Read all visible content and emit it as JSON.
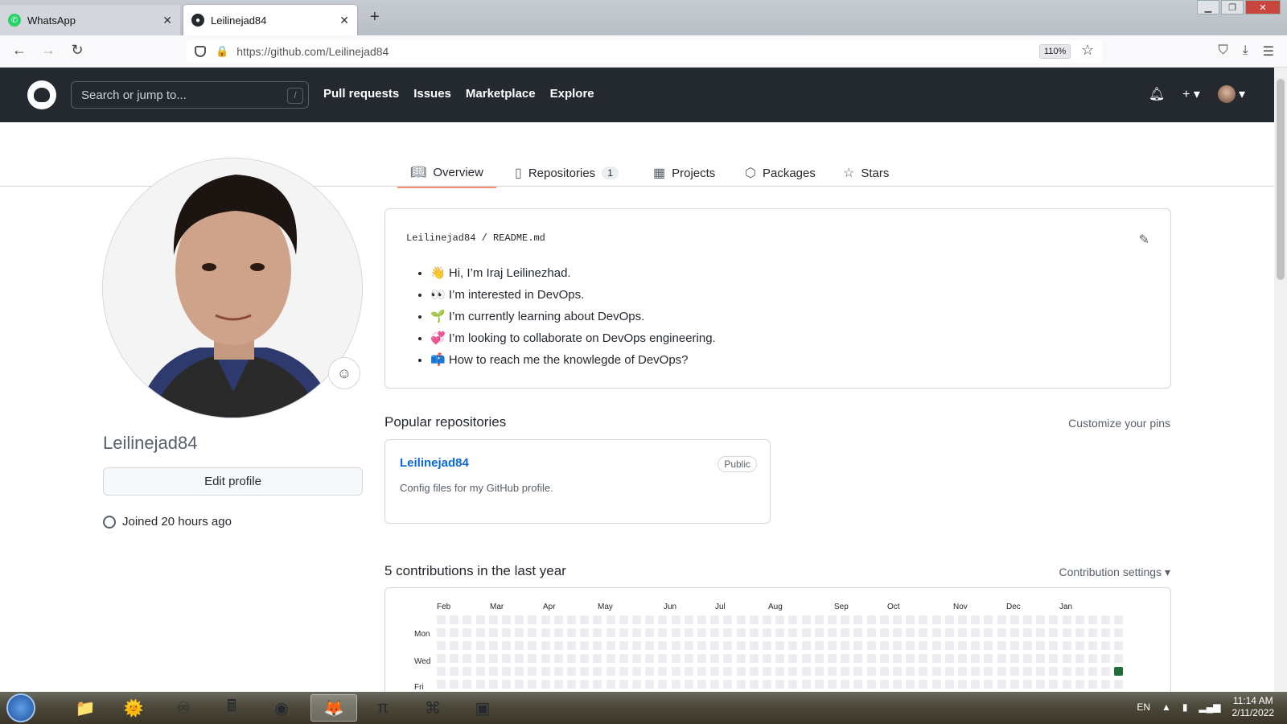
{
  "browser": {
    "tabs": [
      {
        "title": "WhatsApp",
        "icon": "whatsapp-icon",
        "active": false
      },
      {
        "title": "Leilinejad84",
        "icon": "github-icon",
        "active": true
      }
    ],
    "url": "https://github.com/Leilinejad84",
    "zoom": "110%"
  },
  "github": {
    "search_placeholder": "Search or jump to...",
    "search_shortcut": "/",
    "nav": [
      "Pull requests",
      "Issues",
      "Marketplace",
      "Explore"
    ],
    "profile_tabs": [
      {
        "label": "Overview",
        "icon": "book-icon",
        "selected": true,
        "count": ""
      },
      {
        "label": "Repositories",
        "icon": "repo-icon",
        "selected": false,
        "count": "1"
      },
      {
        "label": "Projects",
        "icon": "table-icon",
        "selected": false,
        "count": ""
      },
      {
        "label": "Packages",
        "icon": "package-icon",
        "selected": false,
        "count": ""
      },
      {
        "label": "Stars",
        "icon": "star-icon",
        "selected": false,
        "count": ""
      }
    ]
  },
  "profile": {
    "username": "Leilinejad84",
    "edit_label": "Edit profile",
    "joined": "Joined 20 hours ago"
  },
  "readme": {
    "owner": "Leilinejad84",
    "sep": "/",
    "file": "README.md",
    "items": [
      {
        "emoji": "👋",
        "text": "Hi, I’m Iraj Leilinezhad."
      },
      {
        "emoji": "👀",
        "text": "I’m interested in DevOps."
      },
      {
        "emoji": "🌱",
        "text": "I’m currently learning about DevOps."
      },
      {
        "emoji": "💞️",
        "text": "I’m looking to collaborate on DevOps engineering."
      },
      {
        "emoji": "📫",
        "text": "How to reach me the knowlegde of DevOps?"
      }
    ]
  },
  "popular": {
    "title": "Popular repositories",
    "customize": "Customize your pins",
    "repos": [
      {
        "name": "Leilinejad84",
        "visibility": "Public",
        "description": "Config files for my GitHub profile."
      }
    ]
  },
  "contributions": {
    "title": "5 contributions in the last year",
    "settings": "Contribution settings ▾",
    "months": [
      "Feb",
      "Mar",
      "Apr",
      "May",
      "Jun",
      "Jul",
      "Aug",
      "Sep",
      "Oct",
      "Nov",
      "Dec",
      "Jan"
    ],
    "day_labels": [
      "Mon",
      "Wed",
      "Fri"
    ]
  },
  "taskbar": {
    "lang": "EN",
    "time": "11:14 AM",
    "date": "2/11/2022"
  },
  "colors": {
    "header": "#24292f",
    "accent": "#fd8c73",
    "link": "#0969da",
    "contrib": "#216e39"
  }
}
